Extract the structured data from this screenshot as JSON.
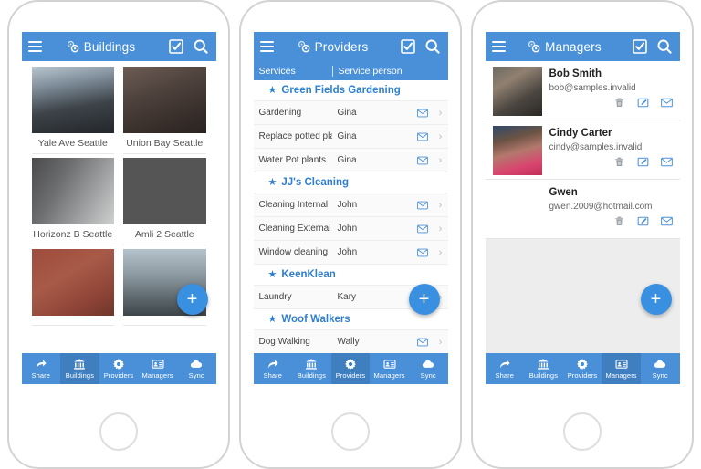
{
  "app": {
    "accent": "#4a90d9",
    "accent_active": "#3f7fc0",
    "fab_color": "#3a90e0",
    "link_color": "#2f7fd1",
    "fab_label": "+",
    "logo_icon": "cells-logo-icon",
    "menu_icon": "hamburger-icon",
    "select_icon": "checkbox-icon",
    "search_icon": "search-icon"
  },
  "bottom_nav": {
    "items": [
      {
        "label": "Share",
        "icon": "share-arrow-icon"
      },
      {
        "label": "Buildings",
        "icon": "bank-columns-icon"
      },
      {
        "label": "Providers",
        "icon": "gear-icon"
      },
      {
        "label": "Managers",
        "icon": "id-card-icon"
      },
      {
        "label": "Sync",
        "icon": "cloud-icon"
      }
    ]
  },
  "phones": [
    {
      "id": "buildings",
      "title": "Buildings",
      "active_nav": "Buildings",
      "buildings": [
        {
          "name": "Yale Ave Seattle",
          "photo": "glass-canopy-entrance"
        },
        {
          "name": "Union Bay Seattle",
          "photo": "brick-building-526"
        },
        {
          "name": "Horizonz B Seattle",
          "photo": "grey-townhouses-walkway"
        },
        {
          "name": "Amli 2 Seattle",
          "photo": "lit-lobby-balconies"
        },
        {
          "name": "",
          "photo": "red-brick-apartment"
        },
        {
          "name": "",
          "photo": "flat-roof-modern"
        }
      ]
    },
    {
      "id": "providers",
      "title": "Providers",
      "active_nav": "Providers",
      "columns": {
        "services": "Services",
        "person": "Service person"
      },
      "groups": [
        {
          "name": "Green Fields Gardening",
          "rows": [
            {
              "service": "Gardening",
              "person": "Gina"
            },
            {
              "service": "Replace potted pla...",
              "person": "Gina"
            },
            {
              "service": "Water Pot plants",
              "person": "Gina"
            }
          ]
        },
        {
          "name": "JJ's Cleaning",
          "rows": [
            {
              "service": "Cleaning Internal",
              "person": "John"
            },
            {
              "service": "Cleaning External",
              "person": "John"
            },
            {
              "service": "Window cleaning",
              "person": "John"
            }
          ]
        },
        {
          "name": "KeenKlean",
          "rows": [
            {
              "service": "Laundry",
              "person": "Kary"
            }
          ]
        },
        {
          "name": "Woof Walkers",
          "rows": [
            {
              "service": "Dog Walking",
              "person": "Wally"
            }
          ]
        }
      ],
      "row_mail_icon": "envelope-icon",
      "row_chevron": "›"
    },
    {
      "id": "managers",
      "title": "Managers",
      "active_nav": "Managers",
      "managers": [
        {
          "name": "Bob Smith",
          "email": "bob@samples.invalid",
          "photo": "man-glasses-portrait"
        },
        {
          "name": "Cindy Carter",
          "email": "cindy@samples.invalid",
          "photo": "woman-pink-portrait"
        },
        {
          "name": "Gwen",
          "email": "gwen.2009@hotmail.com",
          "photo": ""
        }
      ],
      "actions": [
        {
          "icon": "trash-icon"
        },
        {
          "icon": "edit-pencil-icon"
        },
        {
          "icon": "envelope-icon"
        }
      ]
    }
  ]
}
